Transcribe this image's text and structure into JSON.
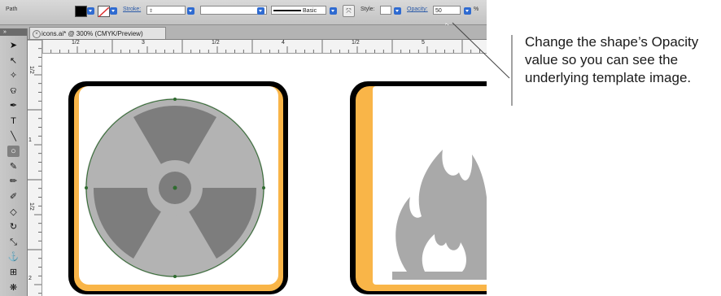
{
  "control_bar": {
    "selection_label": "Path",
    "stroke_label": "Stroke:",
    "brush_label": "Basic",
    "style_label": "Style:",
    "opacity_label": "Opacity:",
    "opacity_value": "50",
    "percent_suffix": "%"
  },
  "document_tab": {
    "title": "icons.ai* @ 300% (CMYK/Preview)"
  },
  "rulers": {
    "horizontal_labels": [
      "1/2",
      "3",
      "1/2",
      "4",
      "1/2",
      "5"
    ],
    "vertical_labels": [
      "1/2",
      "1",
      "1/2",
      "2"
    ]
  },
  "tools": [
    {
      "name": "selection-tool-icon",
      "glyph": "➤"
    },
    {
      "name": "direct-selection-tool-icon",
      "glyph": "↖"
    },
    {
      "name": "magic-wand-tool-icon",
      "glyph": "✧"
    },
    {
      "name": "lasso-tool-icon",
      "glyph": "ଡ"
    },
    {
      "name": "pen-tool-icon",
      "glyph": "✒"
    },
    {
      "name": "type-tool-icon",
      "glyph": "T"
    },
    {
      "name": "line-segment-tool-icon",
      "glyph": "╲"
    },
    {
      "name": "ellipse-tool-icon",
      "glyph": "○"
    },
    {
      "name": "paintbrush-tool-icon",
      "glyph": "✎"
    },
    {
      "name": "pencil-tool-icon",
      "glyph": "✏"
    },
    {
      "name": "blob-brush-tool-icon",
      "glyph": "✐"
    },
    {
      "name": "eraser-tool-icon",
      "glyph": "◇"
    },
    {
      "name": "rotate-tool-icon",
      "glyph": "↻"
    },
    {
      "name": "scale-tool-icon",
      "glyph": "⤡"
    },
    {
      "name": "warp-tool-icon",
      "glyph": "⚓"
    },
    {
      "name": "free-transform-tool-icon",
      "glyph": "⊞"
    },
    {
      "name": "symbol-sprayer-tool-icon",
      "glyph": "❋"
    }
  ],
  "callout": {
    "lines": [
      "Change the shape’s Opacity",
      "value so you can see the",
      "underlying template image."
    ]
  },
  "colors": {
    "accent_orange": "#f9b548",
    "icon_fill_gray": "#a9a9a9",
    "icon_dark_gray": "#7d7d7d",
    "path_green": "#2f6b2f",
    "ui_blue": "#2f6bd1"
  }
}
